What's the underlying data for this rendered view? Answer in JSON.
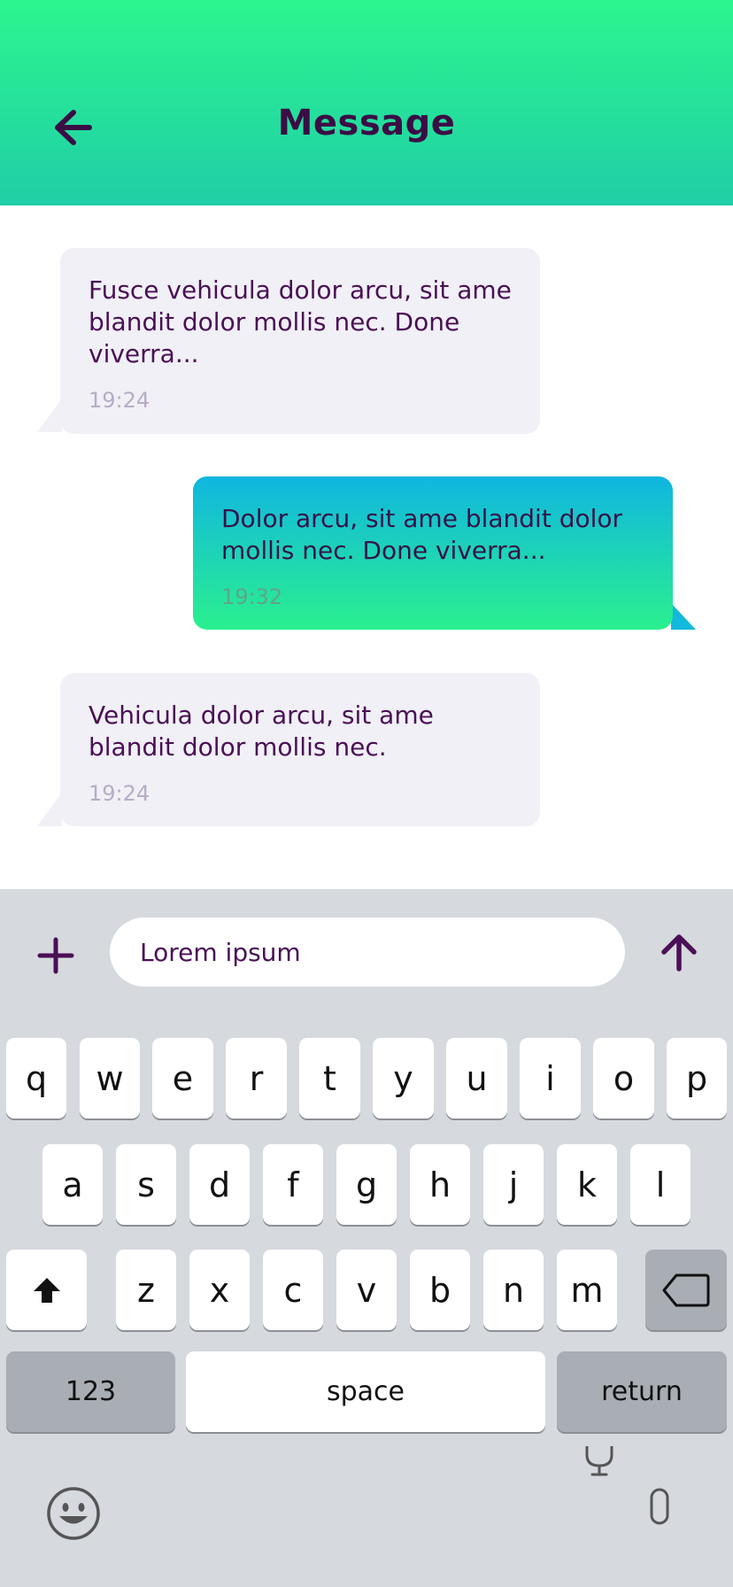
{
  "header": {
    "title": "Message",
    "back_icon": "arrow-left-icon"
  },
  "messages": [
    {
      "direction": "incoming",
      "text": "Fusce vehicula dolor arcu, sit ame blandit dolor mollis nec. Done viverra...",
      "time": "19:24"
    },
    {
      "direction": "outgoing",
      "text": "Dolor arcu, sit ame blandit dolor mollis nec. Done viverra...",
      "time": "19:32"
    },
    {
      "direction": "incoming",
      "text": "Vehicula dolor arcu, sit ame blandit dolor mollis nec.",
      "time": "19:24"
    }
  ],
  "composer": {
    "value": "Lorem ipsum",
    "plus_icon": "plus-icon",
    "send_icon": "arrow-up-icon"
  },
  "keyboard": {
    "row1": [
      "q",
      "w",
      "e",
      "r",
      "t",
      "y",
      "u",
      "i",
      "o",
      "p"
    ],
    "row2": [
      "a",
      "s",
      "d",
      "f",
      "g",
      "h",
      "j",
      "k",
      "l"
    ],
    "row3": [
      "z",
      "x",
      "c",
      "v",
      "b",
      "n",
      "m"
    ],
    "shift_icon": "shift-icon",
    "delete_icon": "backspace-icon",
    "numbers_label": "123",
    "space_label": "space",
    "return_label": "return",
    "emoji_icon": "emoji-icon",
    "mic_icon": "microphone-icon"
  },
  "colors": {
    "header_gradient_top": "#2cf58f",
    "header_gradient_bottom": "#1fcea6",
    "title": "#3b0d45",
    "incoming_bubble": "#f0f0f6",
    "outgoing_gradient_top": "#10b6e0",
    "outgoing_gradient_bottom": "#2af08e",
    "keyboard_bg": "#d6d9de"
  }
}
